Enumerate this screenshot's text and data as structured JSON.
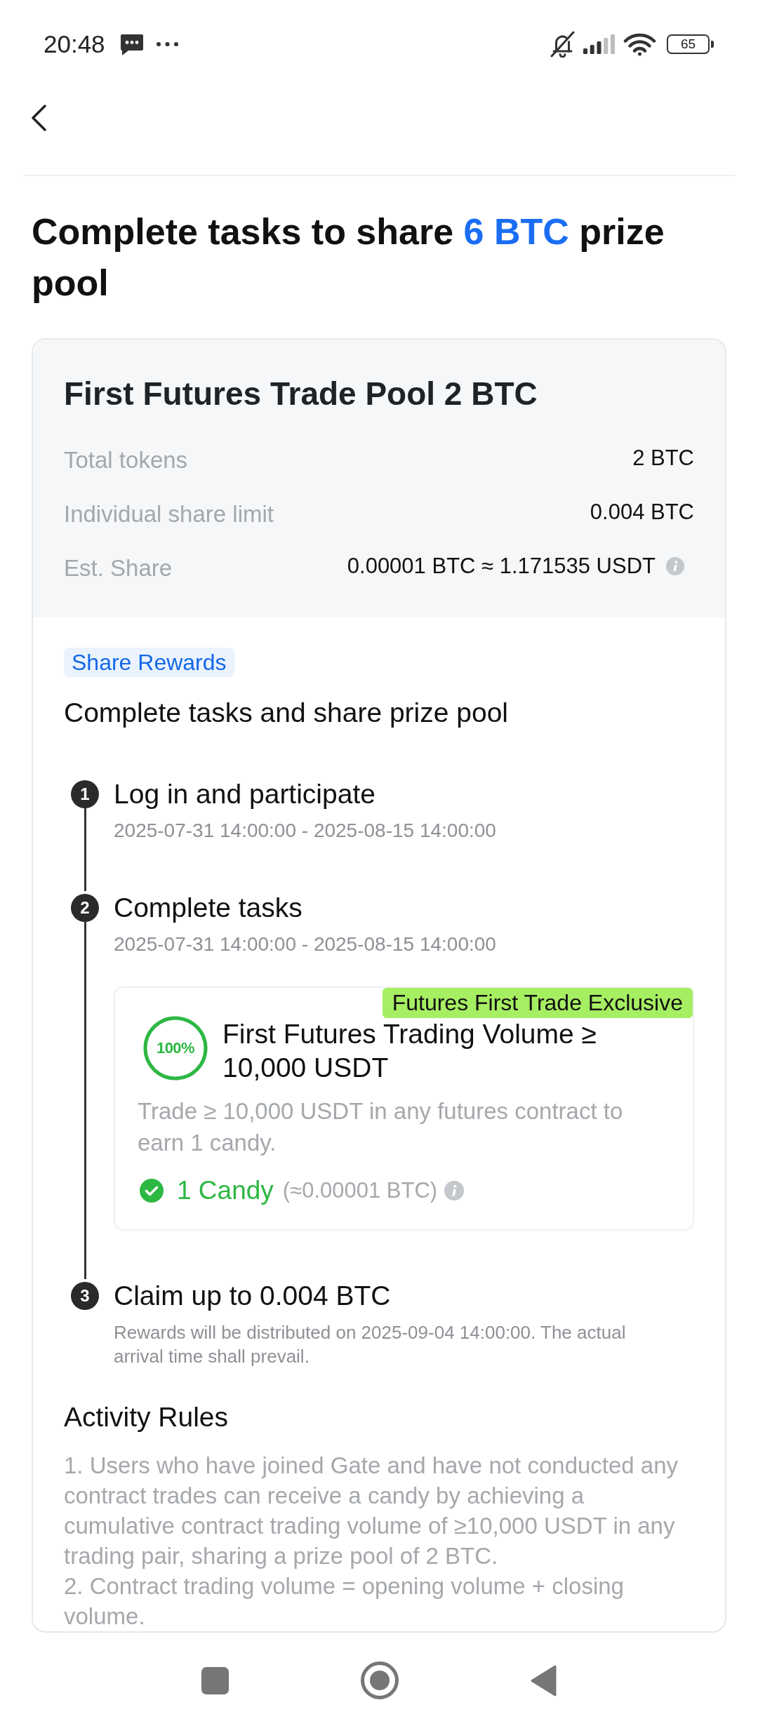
{
  "status_bar": {
    "time": "20:48",
    "battery": "65"
  },
  "title": {
    "before": "Complete tasks to share ",
    "highlight": "6 BTC",
    "after": " prize pool"
  },
  "pool_card": {
    "title": "First Futures Trade Pool 2 BTC",
    "rows": [
      {
        "label": "Total tokens",
        "value": "2 BTC",
        "info": false
      },
      {
        "label": "Individual share limit",
        "value": "0.004 BTC",
        "info": false
      },
      {
        "label": "Est. Share",
        "value": "0.00001 BTC ≈ 1.171535 USDT",
        "info": true
      }
    ]
  },
  "rewards": {
    "tag": "Share Rewards",
    "heading": "Complete tasks and share prize pool",
    "steps": [
      {
        "kind": "dated",
        "number": "1",
        "title": "Log in and participate",
        "subtitle": "2025-07-31 14:00:00 - 2025-08-15 14:00:00"
      },
      {
        "kind": "dated",
        "number": "2",
        "title": "Complete tasks",
        "subtitle": "2025-07-31 14:00:00 - 2025-08-15 14:00:00",
        "task": {
          "badge": "Futures First Trade Exclusive",
          "progress": "100%",
          "level": 1,
          "title": "First Futures Trading Volume ≥ 10,000 USDT",
          "description": "Trade ≥ 10,000 USDT in any futures contract to earn 1 candy.",
          "reward": "1 Candy",
          "reward_note": "(≈0.00001 BTC)",
          "completed": true,
          "info": true
        }
      },
      {
        "kind": "note",
        "number": "3",
        "title": "Claim up to 0.004 BTC",
        "subtitle": "Rewards will be distributed on 2025-09-04 14:00:00. The actual arrival time shall prevail."
      }
    ]
  },
  "activity_rules": {
    "heading": "Activity Rules",
    "items": [
      "1. Users who have joined Gate and have not conducted any contract trades can receive a candy by achieving a cumulative contract trading volume of ≥10,000 USDT in any trading pair, sharing a prize pool of 2 BTC.",
      "2. Contract trading volume = opening volume + closing volume."
    ]
  }
}
